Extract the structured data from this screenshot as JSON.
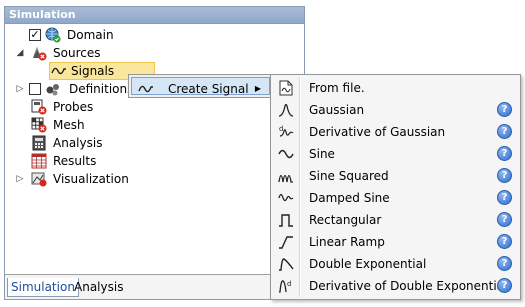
{
  "panel": {
    "title": "Simulation"
  },
  "tree": {
    "domain": "Domain",
    "sources": "Sources",
    "signals": "Signals",
    "definitions": "Definitions",
    "probes": "Probes",
    "mesh": "Mesh",
    "analysis": "Analysis",
    "results": "Results",
    "visualization": "Visualization"
  },
  "tabs": {
    "simulation": "Simulation",
    "analysis": "Analysis"
  },
  "context_menu": {
    "create_signal": "Create Signal"
  },
  "submenu": {
    "from_file": "From file.",
    "gaussian": "Gaussian",
    "derivative_gaussian": "Derivative of Gaussian",
    "sine": "Sine",
    "sine_squared": "Sine Squared",
    "damped_sine": "Damped Sine",
    "rectangular": "Rectangular",
    "linear_ramp": "Linear Ramp",
    "double_exponential": "Double Exponential",
    "derivative_double_exponential": "Derivative of Double Exponential"
  },
  "colors": {
    "selection": "#fbe79b",
    "menu_highlight": "#d5e6f7",
    "header": "#9fb4d2",
    "help": "#2f6fd0"
  }
}
